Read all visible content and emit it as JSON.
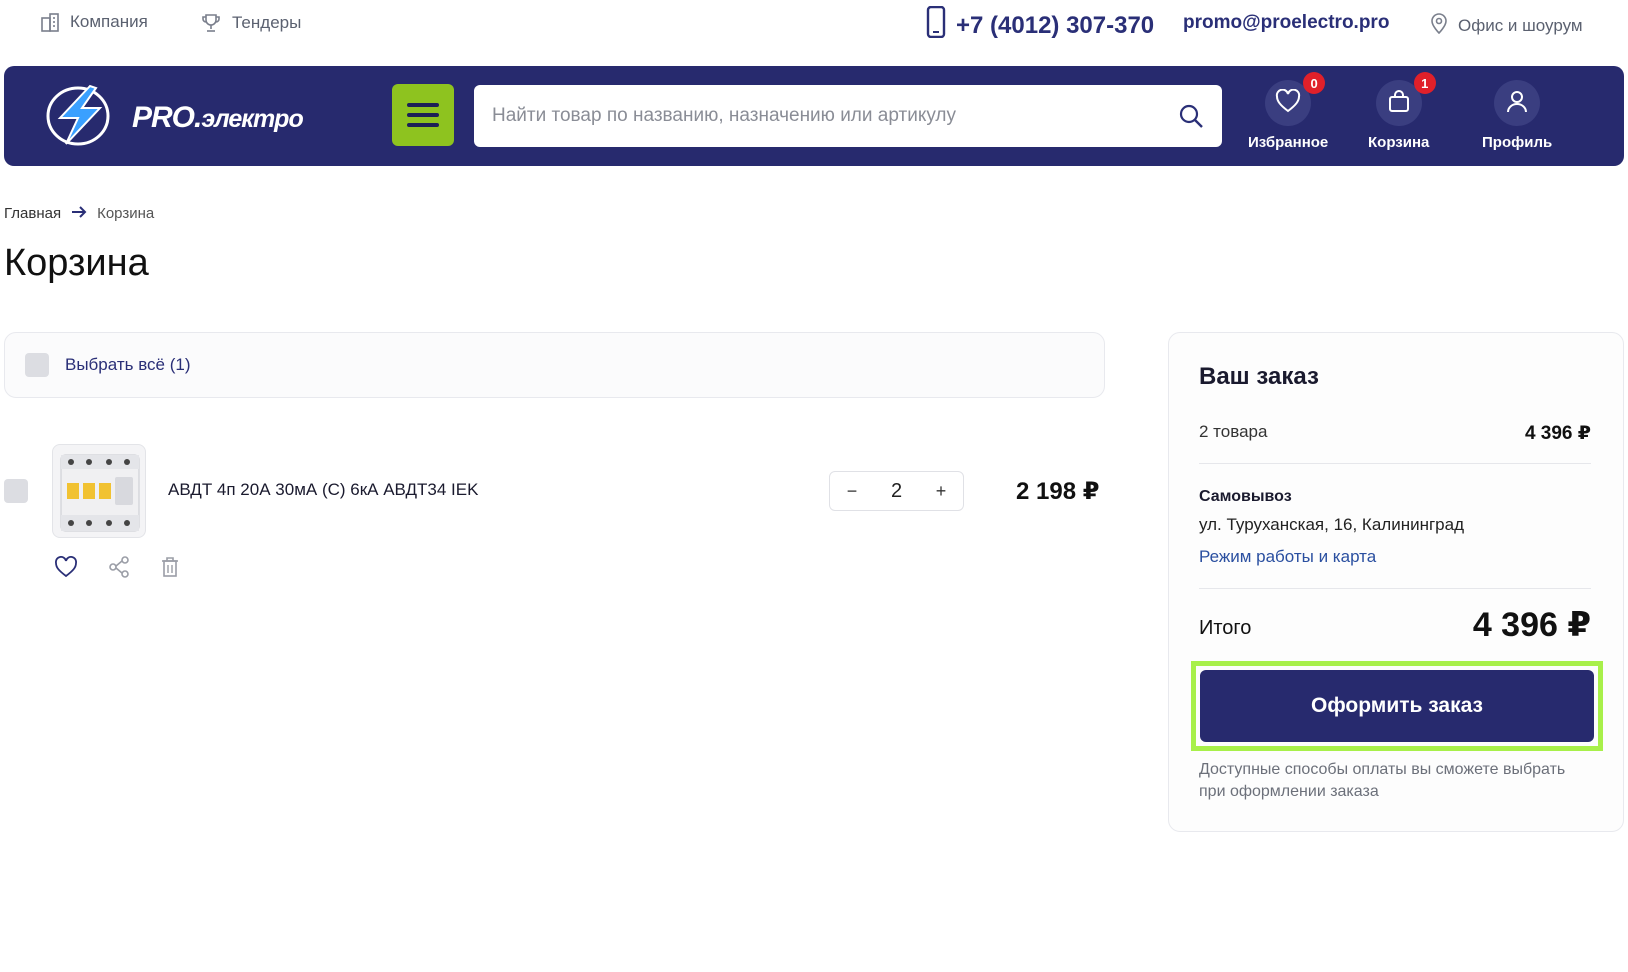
{
  "topbar": {
    "company": "Компания",
    "tenders": "Тендеры",
    "phone": "+7 (4012) 307-370",
    "email": "promo@proelectro.pro",
    "office": "Офис и шоурум"
  },
  "header": {
    "logo_main": "PRO.",
    "logo_sub": "электро",
    "search_placeholder": "Найти товар по названию, назначению или артикулу",
    "favorites_label": "Избранное",
    "favorites_count": "0",
    "cart_label": "Корзина",
    "cart_count": "1",
    "profile_label": "Профиль"
  },
  "breadcrumb": {
    "home": "Главная",
    "current": "Корзина"
  },
  "page_title": "Корзина",
  "select_all_label": "Выбрать всё (1)",
  "cart_item": {
    "name": "АВДТ 4п 20А 30мА (С) 6кА АВДТ34 IEK",
    "quantity": "2",
    "minus": "−",
    "plus": "+",
    "price": "2 198 ₽"
  },
  "summary": {
    "title": "Ваш заказ",
    "items_count": "2 товара",
    "items_amount": "4 396 ₽",
    "pickup_title": "Самовывоз",
    "pickup_address": "ул. Туруханская, 16, Калининград",
    "pickup_link": "Режим работы и карта",
    "total_label": "Итого",
    "total_amount": "4 396 ₽",
    "checkout_button": "Оформить заказ",
    "payment_note": "Доступные способы оплаты вы сможете выбрать при оформлении заказа"
  },
  "colors": {
    "brand_navy": "#272a6e",
    "accent_green": "#8ec31f",
    "highlight_green": "#a8f04a",
    "badge_red": "#e0202a"
  }
}
